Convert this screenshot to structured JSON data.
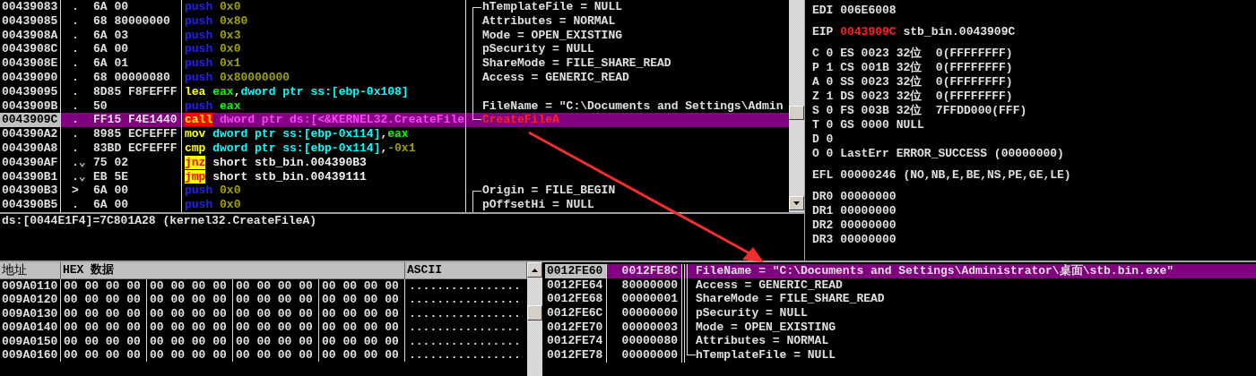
{
  "disasm": {
    "rows": [
      {
        "address": "00439083",
        "marker": ".",
        "bytes": "6A 00",
        "mnemonic": {
          "text": "push",
          "kind": "push"
        },
        "operands": [
          {
            "text": "0x0",
            "kind": "const"
          }
        ],
        "comment": {
          "text": "hTemplateFile = NULL",
          "kind": "arg"
        },
        "bracket": {
          "kind": "top"
        },
        "selected": false
      },
      {
        "address": "00439085",
        "marker": ".",
        "bytes": "68 80000000",
        "mnemonic": {
          "text": "push",
          "kind": "push"
        },
        "operands": [
          {
            "text": "0x80",
            "kind": "const"
          }
        ],
        "comment": {
          "text": "Attributes = NORMAL",
          "kind": "arg"
        },
        "bracket": {
          "kind": "mid"
        },
        "selected": false
      },
      {
        "address": "0043908A",
        "marker": ".",
        "bytes": "6A 03",
        "mnemonic": {
          "text": "push",
          "kind": "push"
        },
        "operands": [
          {
            "text": "0x3",
            "kind": "const"
          }
        ],
        "comment": {
          "text": "Mode = OPEN_EXISTING",
          "kind": "arg"
        },
        "bracket": {
          "kind": "mid"
        },
        "selected": false
      },
      {
        "address": "0043908C",
        "marker": ".",
        "bytes": "6A 00",
        "mnemonic": {
          "text": "push",
          "kind": "push"
        },
        "operands": [
          {
            "text": "0x0",
            "kind": "const"
          }
        ],
        "comment": {
          "text": "pSecurity = NULL",
          "kind": "arg"
        },
        "bracket": {
          "kind": "mid"
        },
        "selected": false
      },
      {
        "address": "0043908E",
        "marker": ".",
        "bytes": "6A 01",
        "mnemonic": {
          "text": "push",
          "kind": "push"
        },
        "operands": [
          {
            "text": "0x1",
            "kind": "const"
          }
        ],
        "comment": {
          "text": "ShareMode = FILE_SHARE_READ",
          "kind": "arg"
        },
        "bracket": {
          "kind": "mid"
        },
        "selected": false
      },
      {
        "address": "00439090",
        "marker": ".",
        "bytes": "68 00000080",
        "mnemonic": {
          "text": "push",
          "kind": "push"
        },
        "operands": [
          {
            "text": "0x80000000",
            "kind": "const"
          }
        ],
        "comment": {
          "text": "Access = GENERIC_READ",
          "kind": "arg"
        },
        "bracket": {
          "kind": "mid"
        },
        "selected": false
      },
      {
        "address": "00439095",
        "marker": ".",
        "bytes": "8D85 F8FEFFF",
        "mnemonic": {
          "text": "lea",
          "kind": "op"
        },
        "operands": [
          {
            "text": "eax",
            "kind": "reg"
          },
          {
            "text": ",",
            "kind": "plain"
          },
          {
            "text": "dword ptr ss:[ebp-0x108]",
            "kind": "mem"
          }
        ],
        "bracket": {
          "kind": "mid"
        },
        "selected": false
      },
      {
        "address": "0043909B",
        "marker": ".",
        "bytes": "50",
        "mnemonic": {
          "text": "push",
          "kind": "push"
        },
        "operands": [
          {
            "text": "eax",
            "kind": "reg"
          }
        ],
        "comment": {
          "text": "FileName = \"C:\\Documents and Settings\\Admin",
          "kind": "arg"
        },
        "bracket": {
          "kind": "mid"
        },
        "selected": false
      },
      {
        "address": "0043909C",
        "marker": ".",
        "bytes": "FF15 F4E1440",
        "mnemonic": {
          "text": "call",
          "kind": "call"
        },
        "operands": [
          {
            "text": "dword ptr ds:[<&KERNEL32.CreateFile",
            "kind": "api"
          }
        ],
        "comment": {
          "text": "CreateFileA",
          "kind": "api"
        },
        "bracket": {
          "kind": "end"
        },
        "selected": true
      },
      {
        "address": "004390A2",
        "marker": ".",
        "bytes": "8985 ECFEFFF",
        "mnemonic": {
          "text": "mov",
          "kind": "op"
        },
        "operands": [
          {
            "text": "dword ptr ss:[ebp-0x114]",
            "kind": "mem"
          },
          {
            "text": ",",
            "kind": "plain"
          },
          {
            "text": "eax",
            "kind": "reg"
          }
        ],
        "selected": false
      },
      {
        "address": "004390A8",
        "marker": ".",
        "bytes": "83BD ECFEFFF",
        "mnemonic": {
          "text": "cmp",
          "kind": "op"
        },
        "operands": [
          {
            "text": "dword ptr ss:[ebp-0x114]",
            "kind": "mem"
          },
          {
            "text": ",",
            "kind": "plain"
          },
          {
            "text": "-0x1",
            "kind": "const"
          }
        ],
        "selected": false
      },
      {
        "address": "004390AF",
        "marker": ".⌄",
        "bytes": "75 02",
        "mnemonic": {
          "text": "jnz",
          "kind": "jump"
        },
        "operands": [
          {
            "text": "short stb_bin.004390B3",
            "kind": "plain"
          }
        ],
        "selected": false
      },
      {
        "address": "004390B1",
        "marker": ".⌄",
        "bytes": "EB 5E",
        "mnemonic": {
          "text": "jmp",
          "kind": "jump"
        },
        "operands": [
          {
            "text": "short stb_bin.00439111",
            "kind": "plain"
          }
        ],
        "selected": false
      },
      {
        "address": "004390B3",
        "marker": ">",
        "bytes": "6A 00",
        "mnemonic": {
          "text": "push",
          "kind": "push"
        },
        "operands": [
          {
            "text": "0x0",
            "kind": "const"
          }
        ],
        "comment": {
          "text": "Origin = FILE_BEGIN",
          "kind": "arg"
        },
        "bracket": {
          "kind": "top"
        },
        "selected": false
      },
      {
        "address": "004390B5",
        "marker": ".",
        "bytes": "6A 00",
        "mnemonic": {
          "text": "push",
          "kind": "push"
        },
        "operands": [
          {
            "text": "0x0",
            "kind": "const"
          }
        ],
        "comment": {
          "text": "pOffsetHi = NULL",
          "kind": "arg"
        },
        "bracket": {
          "kind": "mid"
        },
        "selected": false
      }
    ],
    "info": "ds:[0044E1F4]=7C801A28 (kernel32.CreateFileA)"
  },
  "registers": {
    "groups": [
      [
        {
          "label": "EDI",
          "value": "006E6008",
          "changed": false
        }
      ],
      [
        {
          "label": "EIP",
          "value": "0043909C",
          "note": "stb_bin.0043909C",
          "changed": true
        }
      ],
      [
        {
          "label": "C",
          "value": "0",
          "note": "ES 0023 32位  0(FFFFFFFF)",
          "changed": false
        },
        {
          "label": "P",
          "value": "1",
          "note": "CS 001B 32位  0(FFFFFFFF)",
          "changed": false
        },
        {
          "label": "A",
          "value": "0",
          "note": "SS 0023 32位  0(FFFFFFFF)",
          "changed": false
        },
        {
          "label": "Z",
          "value": "1",
          "note": "DS 0023 32位  0(FFFFFFFF)",
          "changed": false
        },
        {
          "label": "S",
          "value": "0",
          "note": "FS 003B 32位  7FFDD000(FFF)",
          "changed": false
        },
        {
          "label": "T",
          "value": "0",
          "note": "GS 0000 NULL",
          "changed": false
        },
        {
          "label": "D",
          "value": "0",
          "changed": false
        },
        {
          "label": "O",
          "value": "0",
          "note": "LastErr ERROR_SUCCESS (00000000)",
          "changed": false
        }
      ],
      [
        {
          "label": "EFL",
          "value": "00000246",
          "note": "(NO,NB,E,BE,NS,PE,GE,LE)",
          "changed": false
        }
      ],
      [
        {
          "label": "DR0",
          "value": "00000000",
          "changed": false
        },
        {
          "label": "DR1",
          "value": "00000000",
          "changed": false
        },
        {
          "label": "DR2",
          "value": "00000000",
          "changed": false
        },
        {
          "label": "DR3",
          "value": "00000000",
          "changed": false
        }
      ]
    ]
  },
  "dump": {
    "columns": [
      "地址",
      "HEX 数据",
      "ASCII"
    ],
    "rows": [
      {
        "address": "009A0110",
        "hex": [
          "00 00 00 00",
          "00 00 00 00",
          "00 00 00 00",
          "00 00 00 00"
        ],
        "ascii": "................"
      },
      {
        "address": "009A0120",
        "hex": [
          "00 00 00 00",
          "00 00 00 00",
          "00 00 00 00",
          "00 00 00 00"
        ],
        "ascii": "................"
      },
      {
        "address": "009A0130",
        "hex": [
          "00 00 00 00",
          "00 00 00 00",
          "00 00 00 00",
          "00 00 00 00"
        ],
        "ascii": "................"
      },
      {
        "address": "009A0140",
        "hex": [
          "00 00 00 00",
          "00 00 00 00",
          "00 00 00 00",
          "00 00 00 00"
        ],
        "ascii": "................"
      },
      {
        "address": "009A0150",
        "hex": [
          "00 00 00 00",
          "00 00 00 00",
          "00 00 00 00",
          "00 00 00 00"
        ],
        "ascii": "................"
      },
      {
        "address": "009A0160",
        "hex": [
          "00 00 00 00",
          "00 00 00 00",
          "00 00 00 00",
          "00 00 00 00"
        ],
        "ascii": "................"
      }
    ]
  },
  "stack": {
    "rows": [
      {
        "address": "0012FE60",
        "value": "0012FE8C",
        "comment": "FileName = \"C:\\Documents and Settings\\Administrator\\桌面\\stb.bin.exe\"",
        "bracket": {
          "kind": "mid"
        },
        "selected": true
      },
      {
        "address": "0012FE64",
        "value": "80000000",
        "comment": "Access = GENERIC_READ",
        "bracket": {
          "kind": "mid"
        },
        "selected": false
      },
      {
        "address": "0012FE68",
        "value": "00000001",
        "comment": "ShareMode = FILE_SHARE_READ",
        "bracket": {
          "kind": "mid"
        },
        "selected": false
      },
      {
        "address": "0012FE6C",
        "value": "00000000",
        "comment": "pSecurity = NULL",
        "bracket": {
          "kind": "mid"
        },
        "selected": false
      },
      {
        "address": "0012FE70",
        "value": "00000003",
        "comment": "Mode = OPEN_EXISTING",
        "bracket": {
          "kind": "mid"
        },
        "selected": false
      },
      {
        "address": "0012FE74",
        "value": "00000080",
        "comment": "Attributes = NORMAL",
        "bracket": {
          "kind": "mid"
        },
        "selected": false
      },
      {
        "address": "0012FE78",
        "value": "00000000",
        "comment": "hTemplateFile = NULL",
        "bracket": {
          "kind": "end"
        },
        "selected": false
      }
    ]
  },
  "annotations": [
    {
      "kind": "arrow"
    }
  ]
}
